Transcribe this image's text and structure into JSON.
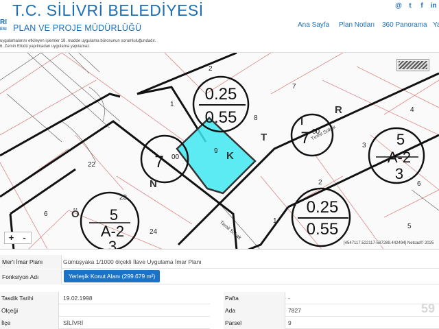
{
  "header": {
    "logo_fragment_line1": "RI",
    "logo_fragment_line2": "ESI",
    "title": "T.C. SİLİVRİ BELEDİYESİ",
    "subtitle": "PLAN VE PROJE MÜDÜRLÜĞÜ"
  },
  "social": [
    "@",
    "t",
    "f",
    "in"
  ],
  "social_icons": [
    "at-icon",
    "twitter-icon",
    "facebook-icon",
    "linkedin-icon"
  ],
  "nav": [
    "Ana Sayfa",
    "Plan Notları",
    "360 Panorama",
    "Ya"
  ],
  "notes": [
    "uygulamalarını etkileyen işlemler 18. madde uygulama bürosunun sorumluluğundadır.",
    "6. Zemin Etüdü yapılmadan uygulama yapılamaz."
  ],
  "map": {
    "density_top": "0.25",
    "density_top_b": "0.55",
    "density_bottom": "0.25",
    "density_bottom_b": "0.55",
    "floor_label_1": "7",
    "floor_label_1_sup": "00",
    "floor_label_2": "7",
    "floor_label_2_sup": "00",
    "zone_1_top": "5",
    "zone_1_mid": "A-2",
    "zone_1_bot": "3",
    "zone_2_top": "5",
    "zone_2_mid": "A-2",
    "zone_2_bot": "3",
    "parcel_numbers": [
      "2",
      "1",
      "8",
      "7",
      "4",
      "3",
      "6",
      "9",
      "22",
      "6",
      "23",
      "24",
      "2",
      "1",
      "5"
    ],
    "street_letters": [
      "K",
      "T",
      "I",
      "R",
      "N",
      "Ö"
    ],
    "street_name_1": "Tırmıl Sokak",
    "street_name_2": "Tirmil Sokak",
    "zoom_in": "+",
    "zoom_out": "-",
    "coords": "[4547117.522117-587289.442494] Netcad© 2025",
    "highlight_color": "#40e8f0"
  },
  "info": {
    "plan_label": "Mer'i İmar Planı",
    "plan_value": "Gümüşyaka 1/1000 ölçekli İlave Uygulama İmar Planı",
    "function_label": "Fonksiyon Adı",
    "function_value": "Yerleşik Konut Alanı (299.679 m²)"
  },
  "details_left": [
    {
      "label": "Tasdik Tarihi",
      "value": "19.02.1998"
    },
    {
      "label": "Ölçeği",
      "value": ""
    },
    {
      "label": "İlçe",
      "value": "SİLİVRİ"
    }
  ],
  "details_right": [
    {
      "label": "Pafta",
      "value": "-"
    },
    {
      "label": "Ada",
      "value": "7827"
    },
    {
      "label": "Parsel",
      "value": "9"
    }
  ],
  "page_number": "59"
}
